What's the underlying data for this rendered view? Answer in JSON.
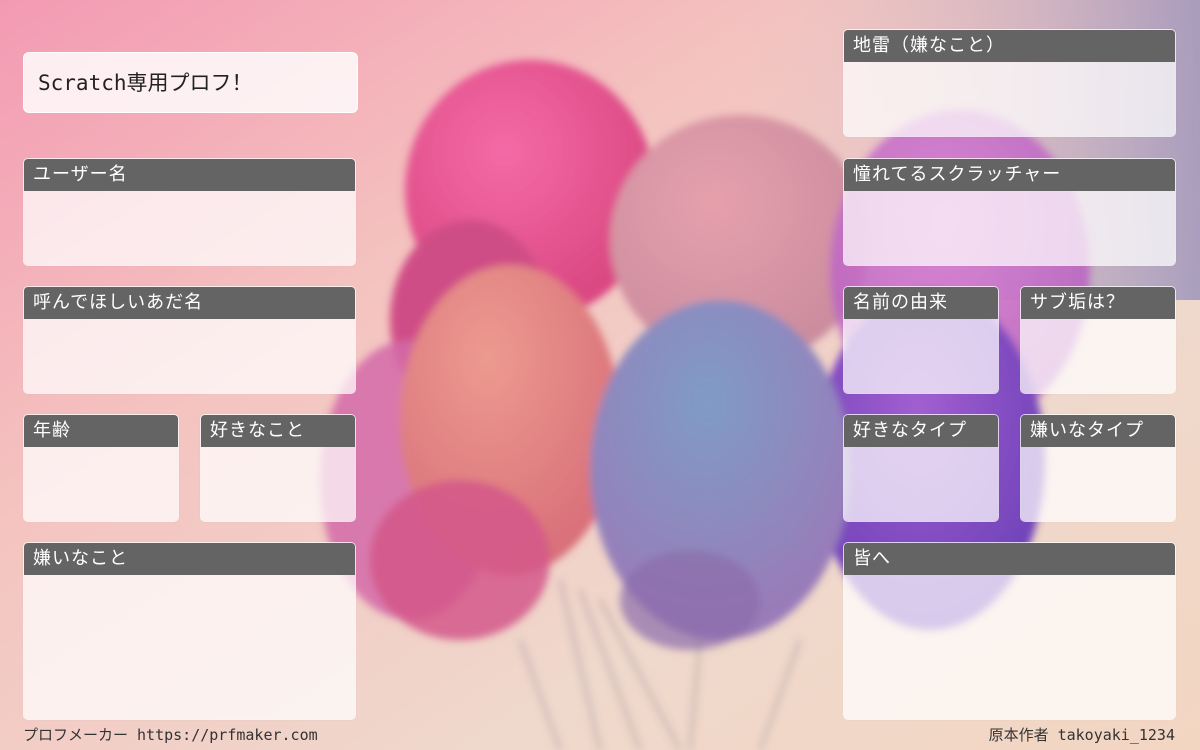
{
  "colors": {
    "header_bg": "#646464",
    "header_text": "#ffffff",
    "card_body": "rgba(255,255,255,0.72)"
  },
  "title": "Scratch専用プロフ！",
  "fields": {
    "username": "ユーザー名",
    "nickname": "呼んでほしいあだ名",
    "age": "年齢",
    "likes": "好きなこと",
    "dislikes": "嫌いなこと",
    "landmine": "地雷（嫌なこと）",
    "admired": "憧れてるスクラッチャー",
    "name_origin": "名前の由来",
    "sub_account": "サブ垢は？",
    "liked_type": "好きなタイプ",
    "disliked_type": "嫌いなタイプ",
    "message": "皆へ"
  },
  "footer": {
    "maker": "プロフメーカー https://prfmaker.com",
    "author": "原本作者 takoyaki_1234"
  }
}
